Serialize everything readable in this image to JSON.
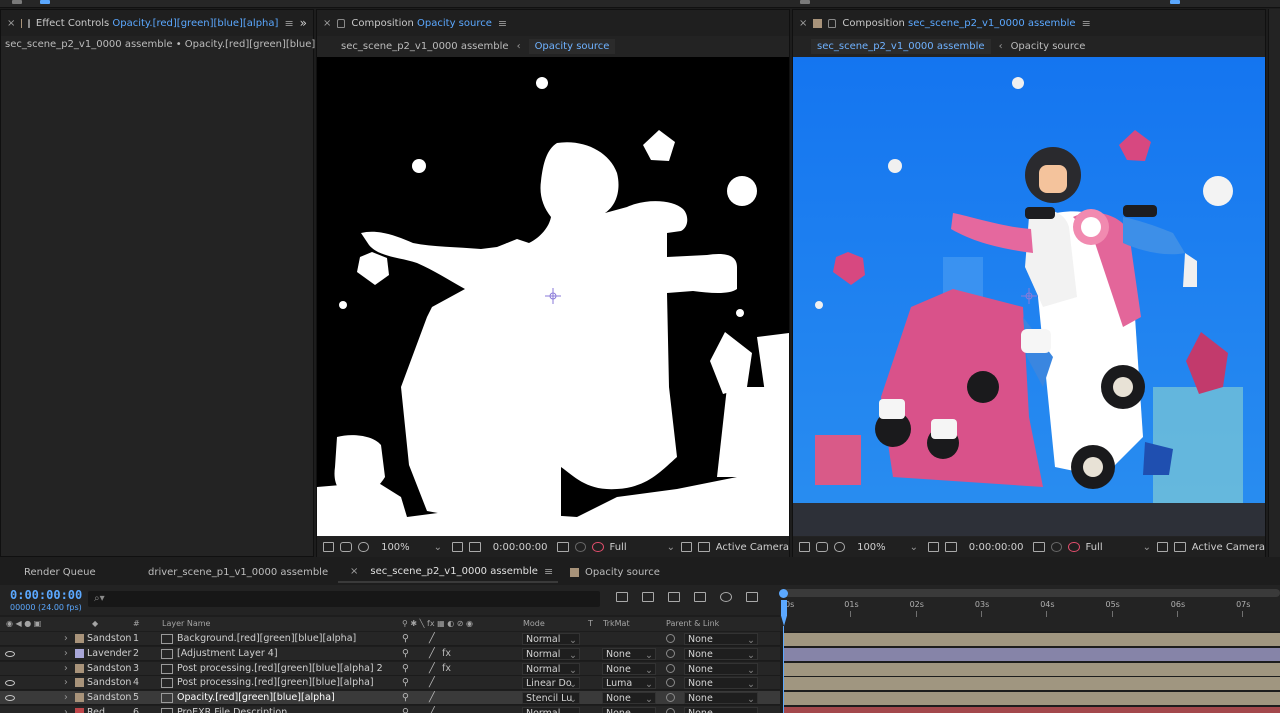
{
  "effect_controls": {
    "tab_prefix": "Effect Controls",
    "tab_highlight": "Opacity.[red][green][blue][alpha]",
    "breadcrumb": "sec_scene_p2_v1_0000 assemble • Opacity.[red][green][blue][alpha]",
    "expand_label": "»"
  },
  "comp_left": {
    "tab_prefix": "Composition",
    "tab_highlight": "Opacity source",
    "sub_inactive": "sec_scene_p2_v1_0000 assemble",
    "sub_active": "Opacity source",
    "zoom": "100%",
    "time": "0:00:00:00",
    "resolution": "Full",
    "camera": "Active Camera"
  },
  "comp_right": {
    "tab_prefix": "Composition",
    "tab_highlight": "sec_scene_p2_v1_0000 assemble",
    "sub_active": "sec_scene_p2_v1_0000 assemble",
    "sub_inactive": "Opacity source",
    "zoom": "100%",
    "time": "0:00:00:00",
    "resolution": "Full",
    "camera": "Active Camera"
  },
  "timeline_tabs": [
    {
      "label": "Render Queue",
      "color": "#1d1d1d"
    },
    {
      "label": "driver_scene_p1_v1_0000 assemble",
      "color": "#a8937a"
    },
    {
      "label": "sec_scene_p2_v1_0000 assemble",
      "color": "#a8937a"
    },
    {
      "label": "Opacity source",
      "color": "#a8937a"
    }
  ],
  "timeline": {
    "timecode": "0:00:00:00",
    "fps": "00000 (24.00 fps)",
    "search_placeholder": "⌕▾",
    "columns": {
      "num": "#",
      "layer_name": "Layer Name",
      "mode": "Mode",
      "t": "T",
      "trkmat": "TrkMat",
      "parent": "Parent & Link"
    },
    "ruler": [
      "0s",
      "01s",
      "02s",
      "03s",
      "04s",
      "05s",
      "06s",
      "07s"
    ]
  },
  "layers": [
    {
      "label": "Sandston",
      "color": "#a8937a",
      "num": "1",
      "name": "Background.[red][green][blue][alpha]",
      "mode": "Normal",
      "trkmat": "",
      "parent": "None",
      "eye": false,
      "fx": false
    },
    {
      "label": "Lavender",
      "color": "#a9a7d8",
      "num": "2",
      "name": "[Adjustment Layer 4]",
      "mode": "Normal",
      "trkmat": "None",
      "parent": "None",
      "eye": true,
      "fx": true
    },
    {
      "label": "Sandston",
      "color": "#a8937a",
      "num": "3",
      "name": "Post processing.[red][green][blue][alpha] 2",
      "mode": "Normal",
      "trkmat": "None",
      "parent": "None",
      "eye": false,
      "fx": true
    },
    {
      "label": "Sandston",
      "color": "#a8937a",
      "num": "4",
      "name": "Post processing.[red][green][blue][alpha]",
      "mode": "Linear Do",
      "trkmat": "Luma",
      "parent": "None",
      "eye": true,
      "fx": false
    },
    {
      "label": "Sandston",
      "color": "#a8937a",
      "num": "5",
      "name": "Opacity.[red][green][blue][alpha]",
      "mode": "Stencil Lu",
      "trkmat": "None",
      "parent": "None",
      "eye": true,
      "fx": false
    },
    {
      "label": "Red",
      "color": "#c0474b",
      "num": "6",
      "name": "ProEXR File Description",
      "mode": "Normal",
      "trkmat": "None",
      "parent": "None",
      "eye": false,
      "fx": false
    }
  ],
  "colors": {
    "accent": "#5ba8ff",
    "scene_blue": "#1e7fef",
    "pink": "#e0608e",
    "layer_bar": "#a09680",
    "layer_bar_lav": "#8684a8",
    "layer_bar_red": "#a3484c"
  }
}
